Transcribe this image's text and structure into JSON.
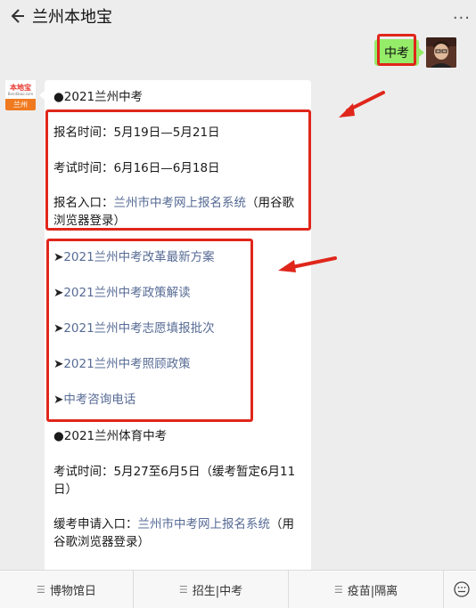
{
  "header": {
    "title": "兰州本地宝",
    "back_icon": "back-arrow-icon",
    "more_icon": "more-dots-icon",
    "more_glyph": "···"
  },
  "user_message": {
    "text": "中考"
  },
  "bot_avatar": {
    "brand": "本地宝",
    "site": "Bendibao.com",
    "city": "兰州"
  },
  "bot_message": {
    "section1_title": "●2021兰州中考",
    "registration_time": "报名时间：5月19日—5月21日",
    "exam_time": "考试时间：6月16日—6月18日",
    "entry_label": "报名入口：",
    "entry_link": "兰州市中考网上报名系统",
    "entry_note_a": "（用谷歌",
    "entry_note_b": "浏览器登录）",
    "links": [
      {
        "marker": "➤",
        "text": "2021兰州中考改革最新方案"
      },
      {
        "marker": "➤",
        "text": "2021兰州中考政策解读"
      },
      {
        "marker": "➤",
        "text": "2021兰州中考志愿填报批次"
      },
      {
        "marker": "➤",
        "text": "2021兰州中考照顾政策"
      },
      {
        "marker": "➤",
        "text": "中考咨询电话"
      }
    ],
    "section2_title": "●2021兰州体育中考",
    "pe_exam_time_a": "考试时间：5月27至6月5日（缓考暂定6月11",
    "pe_exam_time_b": "日）",
    "deferral_label": "缓考申请入口：",
    "deferral_link": "兰州市中考网上报名系统",
    "deferral_note_a": "（用",
    "deferral_note_b": "谷歌浏览器登录）"
  },
  "bottom_tabs": [
    {
      "label": "博物馆日",
      "icon": "menu-icon"
    },
    {
      "label": "招生|中考",
      "icon": "menu-icon"
    },
    {
      "label": "疫苗|隔离",
      "icon": "menu-icon"
    }
  ],
  "menu_glyph": "☰",
  "keyboard_icon": "keyboard-icon",
  "colors": {
    "background": "#ededed",
    "user_bubble": "#95ec69",
    "link": "#576b95",
    "highlight_red": "#e0261b",
    "brand_orange": "#f07a1f"
  }
}
